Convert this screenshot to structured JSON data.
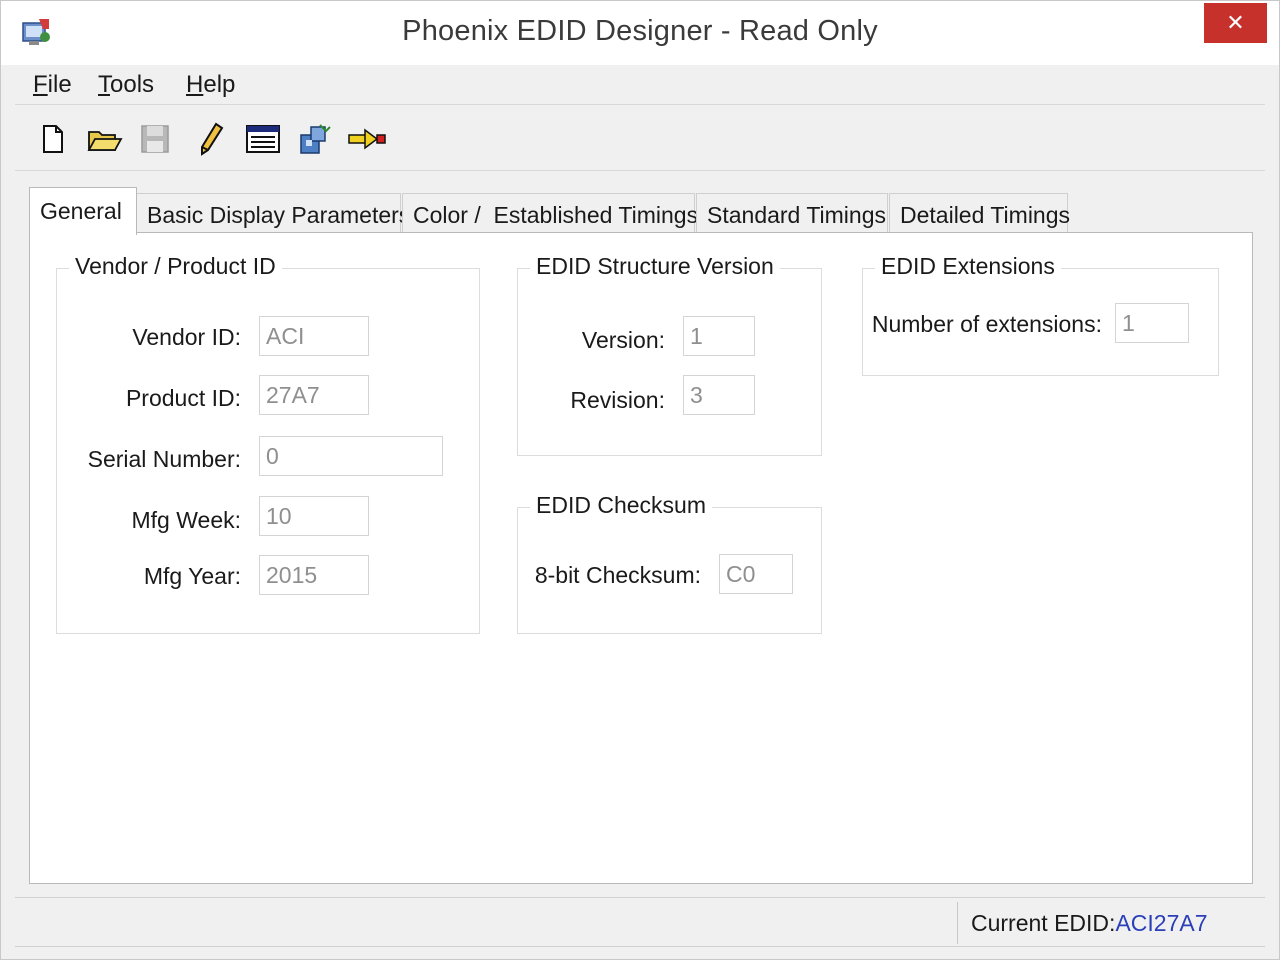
{
  "window": {
    "title": "Phoenix EDID Designer - Read Only",
    "close_glyph": "✕",
    "accent": "#c7312b"
  },
  "menu": [
    {
      "label": "File",
      "mnemonic": "F",
      "rest": "ile"
    },
    {
      "label": "Tools",
      "mnemonic": "T",
      "rest": "ools"
    },
    {
      "label": "Help",
      "mnemonic": "H",
      "rest": "elp"
    }
  ],
  "toolbar": [
    {
      "icon": "new-document-icon"
    },
    {
      "icon": "open-folder-icon"
    },
    {
      "icon": "save-disk-icon"
    },
    {
      "icon": "edit-pencil-icon"
    },
    {
      "icon": "data-grid-icon"
    },
    {
      "icon": "building-blocks-icon"
    },
    {
      "icon": "export-arrow-icon"
    }
  ],
  "tabs": [
    {
      "label": "General",
      "active": true
    },
    {
      "label": "Basic Display Parameters"
    },
    {
      "label": "Color /  Established Timings"
    },
    {
      "label": "Standard Timings"
    },
    {
      "label": "Detailed Timings"
    }
  ],
  "vendor_group": {
    "title": "Vendor / Product ID",
    "vendor_id_label": "Vendor ID:",
    "vendor_id": "ACI",
    "product_id_label": "Product ID:",
    "product_id": "27A7",
    "serial_label": "Serial Number:",
    "serial": "0",
    "mfg_week_label": "Mfg Week:",
    "mfg_week": "10",
    "mfg_year_label": "Mfg Year:",
    "mfg_year": "2015"
  },
  "structure_group": {
    "title": "EDID Structure Version",
    "version_label": "Version:",
    "version": "1",
    "revision_label": "Revision:",
    "revision": "3"
  },
  "checksum_group": {
    "title": "EDID Checksum",
    "checksum_label": "8-bit Checksum:",
    "checksum": "C0"
  },
  "extensions_group": {
    "title": "EDID Extensions",
    "count_label": "Number of extensions:",
    "count": "1"
  },
  "status": {
    "label": "Current EDID:",
    "value": "ACI27A7",
    "value_color": "#2a3fb8"
  }
}
